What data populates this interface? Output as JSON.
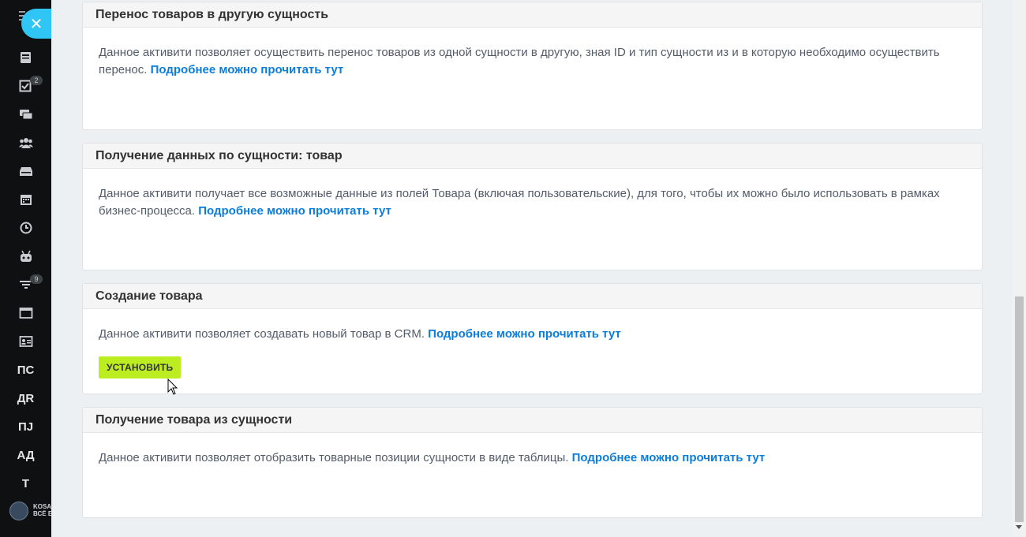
{
  "sidebar": {
    "close_glyph": "✕",
    "icons": [
      {
        "name": "feed-icon",
        "badge": ""
      },
      {
        "name": "tasks-icon",
        "badge": "2"
      },
      {
        "name": "chat-icon",
        "badge": ""
      },
      {
        "name": "groups-icon",
        "badge": ""
      },
      {
        "name": "drive-icon",
        "badge": ""
      },
      {
        "name": "calendar-icon",
        "badge": ""
      },
      {
        "name": "clock-icon",
        "badge": ""
      },
      {
        "name": "robot-icon",
        "badge": ""
      },
      {
        "name": "funnel-icon",
        "badge": "9"
      },
      {
        "name": "window-icon",
        "badge": ""
      },
      {
        "name": "contact-card-icon",
        "badge": ""
      }
    ],
    "text_items": [
      "ПС",
      "ДR",
      "ПJ",
      "АД",
      "Т"
    ],
    "logo_text_line1": "KOSA",
    "logo_text_line2": "ВСЁ Е"
  },
  "cards": [
    {
      "title": "Перенос товаров в другую сущность",
      "description": "Данное активити позволяет осуществить перенос товаров из одной сущности в другую, зная ID и тип сущности из и в которую необходимо осуществить перенос.",
      "link": "Подробнее можно прочитать тут"
    },
    {
      "title": "Получение данных по сущности: товар",
      "description": "Данное активити получает все возможные данные из полей Товара (включая пользовательские), для того, чтобы их можно было использовать в рамках бизнес-процесса.",
      "link": "Подробнее можно прочитать тут"
    },
    {
      "title": "Создание товара",
      "description": "Данное активити позволяет создавать новый товар в CRM.",
      "link": "Подробнее можно прочитать тут",
      "button": "УСТАНОВИТЬ"
    },
    {
      "title": "Получение товара из сущности",
      "description": "Данное активити позволяет отобразить товарные позиции сущности в виде таблицы.",
      "link": "Подробнее можно прочитать тут"
    }
  ],
  "colors": {
    "sidebar_bg": "#0e1012",
    "accent": "#2fc6f6",
    "link": "#0b7ddb",
    "install_button": "#bbed21"
  }
}
